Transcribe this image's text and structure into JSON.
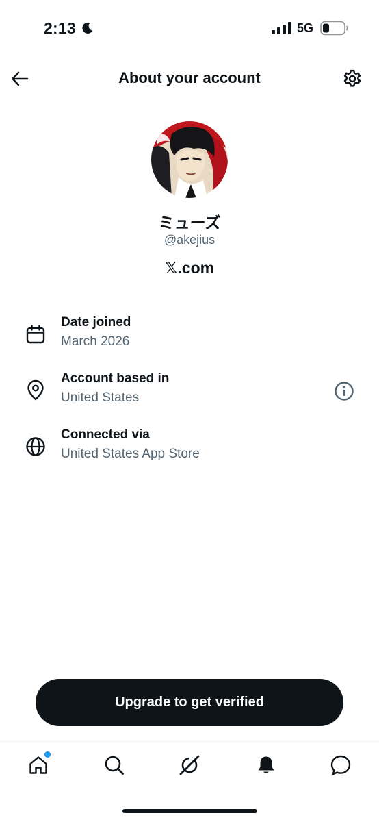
{
  "status_bar": {
    "time": "2:13",
    "network": "5G"
  },
  "header": {
    "title": "About your account",
    "back_icon": "arrow-left-icon",
    "settings_icon": "gear-icon"
  },
  "profile": {
    "display_name": "ミューズ",
    "handle": "@akejius",
    "domain": "𝕏.com"
  },
  "info": [
    {
      "label": "Date joined",
      "value": "March 2026",
      "icon": "calendar-icon"
    },
    {
      "label": "Account based in",
      "value": "United States",
      "icon": "location-pin-icon",
      "action_icon": "info-icon"
    },
    {
      "label": "Connected via",
      "value": "United States App Store",
      "icon": "globe-icon"
    }
  ],
  "upgrade_button": {
    "label": "Upgrade to get verified"
  },
  "nav": {
    "items": [
      "home-icon",
      "search-icon",
      "grok-icon",
      "notifications-icon",
      "messages-icon"
    ]
  },
  "colors": {
    "text": "#0f1419",
    "secondary": "#536471",
    "accent": "#1d9bf0"
  }
}
